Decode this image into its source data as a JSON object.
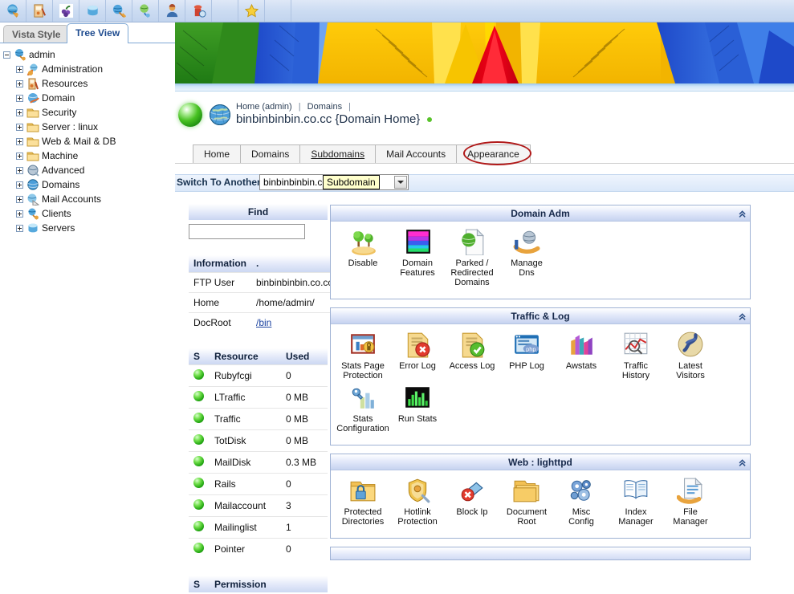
{
  "toolbar": {
    "buttons": [
      {
        "name": "admin-icon",
        "title": "Admin"
      },
      {
        "name": "resources-icon",
        "title": "Resources"
      },
      {
        "name": "grapes-icon",
        "title": "Domain"
      },
      {
        "name": "box-icon",
        "title": "Servers"
      },
      {
        "name": "globe-brush-icon",
        "title": "Appearance"
      },
      {
        "name": "world-hand-icon",
        "title": "Dns"
      },
      {
        "name": "user-icon",
        "title": "Clients"
      },
      {
        "name": "mail-icon",
        "title": "Mail"
      }
    ],
    "favorite": {
      "name": "star-icon",
      "title": "Favorites"
    }
  },
  "sidebar": {
    "tabs": [
      {
        "label": "Vista Style",
        "active": false
      },
      {
        "label": "Tree View",
        "active": true
      }
    ],
    "root": {
      "label": "admin",
      "icon": "admin-globe-icon"
    },
    "items": [
      {
        "label": "Administration",
        "icon": "administration-icon"
      },
      {
        "label": "Resources",
        "icon": "resources-icon"
      },
      {
        "label": "Domain",
        "icon": "domain-icon"
      },
      {
        "label": "Security",
        "icon": "folder-icon"
      },
      {
        "label": "Server  : linux",
        "icon": "folder-icon"
      },
      {
        "label": "Web & Mail & DB",
        "icon": "folder-icon"
      },
      {
        "label": "Machine",
        "icon": "folder-icon"
      },
      {
        "label": "Advanced",
        "icon": "advanced-icon"
      },
      {
        "label": "Domains",
        "icon": "domains-globe-icon"
      },
      {
        "label": "Mail Accounts",
        "icon": "mail-accounts-icon"
      },
      {
        "label": "Clients",
        "icon": "clients-icon"
      },
      {
        "label": "Servers",
        "icon": "servers-icon"
      }
    ]
  },
  "breadcrumb": {
    "home": "Home (admin)",
    "sep1": "|",
    "domains": "Domains",
    "sep2": "|",
    "title": "binbinbinbin.co.cc {Domain Home}"
  },
  "tabs": [
    {
      "label": "Home",
      "active": false,
      "marked": false
    },
    {
      "label": "Domains",
      "active": false,
      "marked": false
    },
    {
      "label": "Subdomains",
      "active": false,
      "marked": true
    },
    {
      "label": "Mail Accounts",
      "active": false,
      "marked": false
    },
    {
      "label": "Appearance",
      "active": false,
      "marked": false
    }
  ],
  "switchbar": {
    "label": "Switch To Another",
    "selected": "binbinbinbin.co.cc",
    "tooltip": "Subdomain"
  },
  "find": {
    "title": "Find",
    "value": "",
    "placeholder": ""
  },
  "information": {
    "headers": [
      "Information",
      "."
    ],
    "rows": [
      {
        "key": "FTP User",
        "value": "binbinbinbin.co.cc",
        "link": false
      },
      {
        "key": "Home",
        "value": "/home/admin/",
        "link": false
      },
      {
        "key": "DocRoot",
        "value": "/bin",
        "link": true
      }
    ]
  },
  "resources": {
    "headers": [
      "S",
      "Resource",
      "Used"
    ],
    "rows": [
      {
        "status": "ok",
        "resource": "Rubyfcgi",
        "used": "0"
      },
      {
        "status": "ok",
        "resource": "LTraffic",
        "used": "0 MB"
      },
      {
        "status": "ok",
        "resource": "Traffic",
        "used": "0 MB"
      },
      {
        "status": "ok",
        "resource": "TotDisk",
        "used": "0 MB"
      },
      {
        "status": "ok",
        "resource": "MailDisk",
        "used": "0.3 MB"
      },
      {
        "status": "ok",
        "resource": "Rails",
        "used": "0"
      },
      {
        "status": "ok",
        "resource": "Mailaccount",
        "used": "3"
      },
      {
        "status": "ok",
        "resource": "Mailinglist",
        "used": "1"
      },
      {
        "status": "ok",
        "resource": "Pointer",
        "used": "0"
      }
    ]
  },
  "permission": {
    "headers": [
      "S",
      "Permission"
    ]
  },
  "panels": [
    {
      "title": "Domain Adm",
      "collapse_icon": "chevron-up-icon",
      "tiles": [
        {
          "label": "Disable",
          "icon": "disable-trees-icon"
        },
        {
          "label": "Domain\nFeatures",
          "icon": "domain-features-icon"
        },
        {
          "label": "Parked /\nRedirected\nDomains",
          "icon": "parked-domains-icon"
        },
        {
          "label": "Manage\nDns",
          "icon": "manage-dns-icon"
        }
      ]
    },
    {
      "title": "Traffic & Log",
      "collapse_icon": "chevron-up-icon",
      "tiles": [
        {
          "label": "Stats Page\nProtection",
          "icon": "stats-page-protection-icon"
        },
        {
          "label": "Error Log",
          "icon": "error-log-icon"
        },
        {
          "label": "Access Log",
          "icon": "access-log-icon"
        },
        {
          "label": "PHP Log",
          "icon": "php-log-icon"
        },
        {
          "label": "Awstats",
          "icon": "awstats-icon"
        },
        {
          "label": "Traffic\nHistory",
          "icon": "traffic-history-icon"
        },
        {
          "label": "Latest\nVisitors",
          "icon": "latest-visitors-icon"
        },
        {
          "label": "Stats\nConfiguration",
          "icon": "stats-configuration-icon"
        },
        {
          "label": "Run Stats",
          "icon": "run-stats-icon"
        }
      ]
    },
    {
      "title": "Web : lighttpd",
      "collapse_icon": "chevron-up-icon",
      "tiles": [
        {
          "label": "Protected\nDirectories",
          "icon": "protected-directories-icon"
        },
        {
          "label": "Hotlink\nProtection",
          "icon": "hotlink-protection-icon"
        },
        {
          "label": "Block Ip",
          "icon": "block-ip-icon"
        },
        {
          "label": "Document\nRoot",
          "icon": "document-root-icon"
        },
        {
          "label": "Misc\nConfig",
          "icon": "misc-config-icon"
        },
        {
          "label": "Index\nManager",
          "icon": "index-manager-icon"
        },
        {
          "label": "File\nManager",
          "icon": "file-manager-icon"
        }
      ]
    }
  ],
  "colors": {
    "panel_border": "#9fb2d4",
    "panel_head_from": "#ffffff",
    "panel_head_to": "#c6d3f0",
    "toolbar_bg": "#ccdcf2",
    "annotation_red": "#b01818",
    "status_green": "#22a512",
    "link_blue": "#1c43a0",
    "tab_active_text": "#1e4b8f"
  }
}
